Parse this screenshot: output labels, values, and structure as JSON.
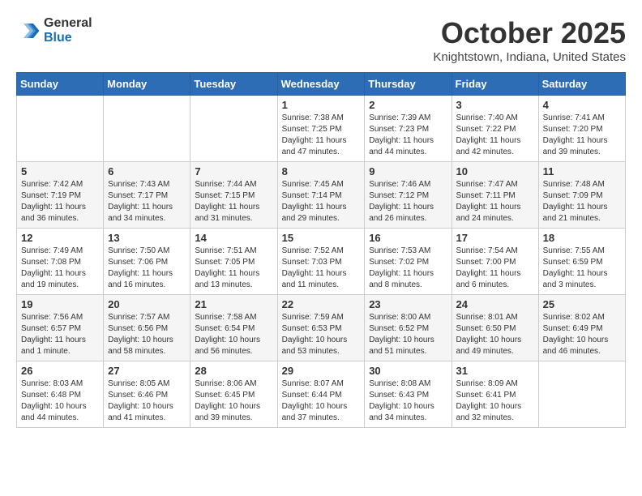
{
  "logo": {
    "general": "General",
    "blue": "Blue"
  },
  "header": {
    "month": "October 2025",
    "location": "Knightstown, Indiana, United States"
  },
  "weekdays": [
    "Sunday",
    "Monday",
    "Tuesday",
    "Wednesday",
    "Thursday",
    "Friday",
    "Saturday"
  ],
  "weeks": [
    [
      {
        "day": "",
        "info": ""
      },
      {
        "day": "",
        "info": ""
      },
      {
        "day": "",
        "info": ""
      },
      {
        "day": "1",
        "info": "Sunrise: 7:38 AM\nSunset: 7:25 PM\nDaylight: 11 hours and 47 minutes."
      },
      {
        "day": "2",
        "info": "Sunrise: 7:39 AM\nSunset: 7:23 PM\nDaylight: 11 hours and 44 minutes."
      },
      {
        "day": "3",
        "info": "Sunrise: 7:40 AM\nSunset: 7:22 PM\nDaylight: 11 hours and 42 minutes."
      },
      {
        "day": "4",
        "info": "Sunrise: 7:41 AM\nSunset: 7:20 PM\nDaylight: 11 hours and 39 minutes."
      }
    ],
    [
      {
        "day": "5",
        "info": "Sunrise: 7:42 AM\nSunset: 7:19 PM\nDaylight: 11 hours and 36 minutes."
      },
      {
        "day": "6",
        "info": "Sunrise: 7:43 AM\nSunset: 7:17 PM\nDaylight: 11 hours and 34 minutes."
      },
      {
        "day": "7",
        "info": "Sunrise: 7:44 AM\nSunset: 7:15 PM\nDaylight: 11 hours and 31 minutes."
      },
      {
        "day": "8",
        "info": "Sunrise: 7:45 AM\nSunset: 7:14 PM\nDaylight: 11 hours and 29 minutes."
      },
      {
        "day": "9",
        "info": "Sunrise: 7:46 AM\nSunset: 7:12 PM\nDaylight: 11 hours and 26 minutes."
      },
      {
        "day": "10",
        "info": "Sunrise: 7:47 AM\nSunset: 7:11 PM\nDaylight: 11 hours and 24 minutes."
      },
      {
        "day": "11",
        "info": "Sunrise: 7:48 AM\nSunset: 7:09 PM\nDaylight: 11 hours and 21 minutes."
      }
    ],
    [
      {
        "day": "12",
        "info": "Sunrise: 7:49 AM\nSunset: 7:08 PM\nDaylight: 11 hours and 19 minutes."
      },
      {
        "day": "13",
        "info": "Sunrise: 7:50 AM\nSunset: 7:06 PM\nDaylight: 11 hours and 16 minutes."
      },
      {
        "day": "14",
        "info": "Sunrise: 7:51 AM\nSunset: 7:05 PM\nDaylight: 11 hours and 13 minutes."
      },
      {
        "day": "15",
        "info": "Sunrise: 7:52 AM\nSunset: 7:03 PM\nDaylight: 11 hours and 11 minutes."
      },
      {
        "day": "16",
        "info": "Sunrise: 7:53 AM\nSunset: 7:02 PM\nDaylight: 11 hours and 8 minutes."
      },
      {
        "day": "17",
        "info": "Sunrise: 7:54 AM\nSunset: 7:00 PM\nDaylight: 11 hours and 6 minutes."
      },
      {
        "day": "18",
        "info": "Sunrise: 7:55 AM\nSunset: 6:59 PM\nDaylight: 11 hours and 3 minutes."
      }
    ],
    [
      {
        "day": "19",
        "info": "Sunrise: 7:56 AM\nSunset: 6:57 PM\nDaylight: 11 hours and 1 minute."
      },
      {
        "day": "20",
        "info": "Sunrise: 7:57 AM\nSunset: 6:56 PM\nDaylight: 10 hours and 58 minutes."
      },
      {
        "day": "21",
        "info": "Sunrise: 7:58 AM\nSunset: 6:54 PM\nDaylight: 10 hours and 56 minutes."
      },
      {
        "day": "22",
        "info": "Sunrise: 7:59 AM\nSunset: 6:53 PM\nDaylight: 10 hours and 53 minutes."
      },
      {
        "day": "23",
        "info": "Sunrise: 8:00 AM\nSunset: 6:52 PM\nDaylight: 10 hours and 51 minutes."
      },
      {
        "day": "24",
        "info": "Sunrise: 8:01 AM\nSunset: 6:50 PM\nDaylight: 10 hours and 49 minutes."
      },
      {
        "day": "25",
        "info": "Sunrise: 8:02 AM\nSunset: 6:49 PM\nDaylight: 10 hours and 46 minutes."
      }
    ],
    [
      {
        "day": "26",
        "info": "Sunrise: 8:03 AM\nSunset: 6:48 PM\nDaylight: 10 hours and 44 minutes."
      },
      {
        "day": "27",
        "info": "Sunrise: 8:05 AM\nSunset: 6:46 PM\nDaylight: 10 hours and 41 minutes."
      },
      {
        "day": "28",
        "info": "Sunrise: 8:06 AM\nSunset: 6:45 PM\nDaylight: 10 hours and 39 minutes."
      },
      {
        "day": "29",
        "info": "Sunrise: 8:07 AM\nSunset: 6:44 PM\nDaylight: 10 hours and 37 minutes."
      },
      {
        "day": "30",
        "info": "Sunrise: 8:08 AM\nSunset: 6:43 PM\nDaylight: 10 hours and 34 minutes."
      },
      {
        "day": "31",
        "info": "Sunrise: 8:09 AM\nSunset: 6:41 PM\nDaylight: 10 hours and 32 minutes."
      },
      {
        "day": "",
        "info": ""
      }
    ]
  ]
}
